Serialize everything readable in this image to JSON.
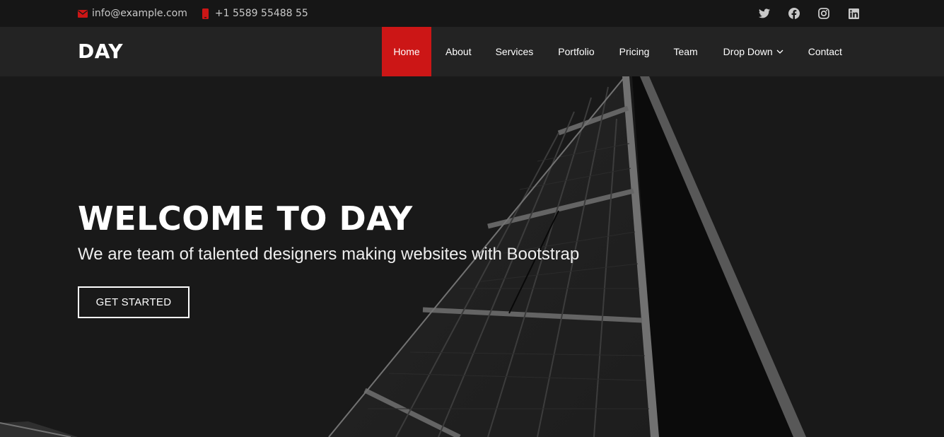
{
  "topbar": {
    "email": "info@example.com",
    "email_icon": "envelope-icon",
    "phone": "+1 5589 55488 55",
    "phone_icon": "phone-icon",
    "social": [
      "twitter-icon",
      "facebook-icon",
      "instagram-icon",
      "linkedin-icon"
    ]
  },
  "header": {
    "logo": "DAY",
    "nav": {
      "home": "Home",
      "about": "About",
      "services": "Services",
      "portfolio": "Portfolio",
      "pricing": "Pricing",
      "team": "Team",
      "dropdown": "Drop Down",
      "contact": "Contact"
    },
    "active_item": "Home"
  },
  "hero": {
    "title": "WELCOME TO DAY",
    "subtitle": "We are team of talented designers making websites with Bootstrap",
    "cta": "GET STARTED"
  },
  "colors": {
    "accent": "#cc1616",
    "topbar_bg": "#161616",
    "header_bg": "#232323",
    "hero_bg": "#1f1f1f"
  }
}
